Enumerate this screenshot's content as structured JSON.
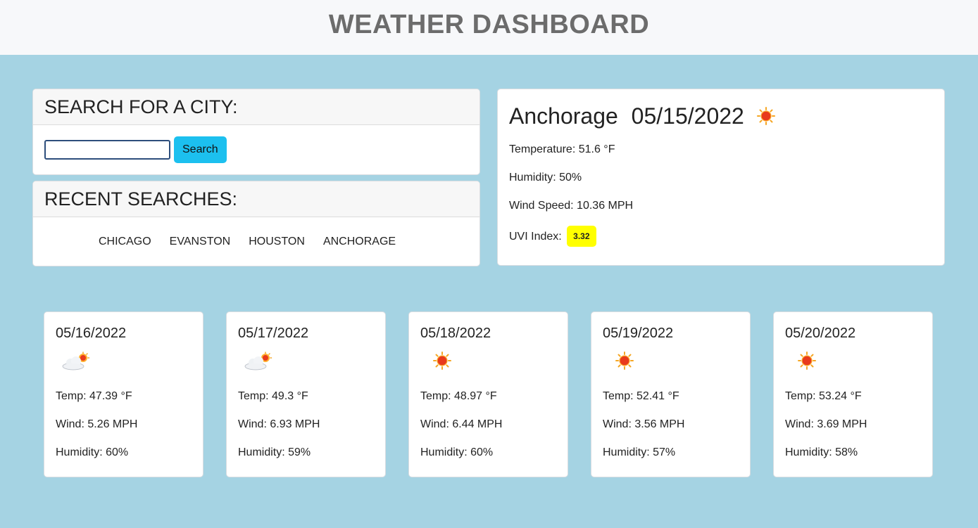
{
  "header": {
    "title": "WEATHER DASHBOARD"
  },
  "search": {
    "heading": "SEARCH FOR A CITY:",
    "input_value": "",
    "button_label": "Search"
  },
  "recent": {
    "heading": "RECENT SEARCHES:",
    "items": [
      "CHICAGO",
      "EVANSTON",
      "HOUSTON",
      "ANCHORAGE"
    ]
  },
  "current": {
    "city": "Anchorage",
    "date": "05/15/2022",
    "icon": "sun-icon",
    "temperature": "Temperature: 51.6 °F",
    "humidity": "Humidity: 50%",
    "wind": "Wind Speed: 10.36 MPH",
    "uvi_label": "UVI Index:",
    "uvi_value": "3.32",
    "uvi_color": "#ffff00"
  },
  "forecast": [
    {
      "date": "05/16/2022",
      "icon": "partly-cloudy-icon",
      "temp": "Temp: 47.39 °F",
      "wind": "Wind: 5.26 MPH",
      "humidity": "Humidity: 60%"
    },
    {
      "date": "05/17/2022",
      "icon": "partly-cloudy-icon",
      "temp": "Temp: 49.3 °F",
      "wind": "Wind: 6.93 MPH",
      "humidity": "Humidity: 59%"
    },
    {
      "date": "05/18/2022",
      "icon": "sun-icon",
      "temp": "Temp: 48.97 °F",
      "wind": "Wind: 6.44 MPH",
      "humidity": "Humidity: 60%"
    },
    {
      "date": "05/19/2022",
      "icon": "sun-icon",
      "temp": "Temp: 52.41 °F",
      "wind": "Wind: 3.56 MPH",
      "humidity": "Humidity: 57%"
    },
    {
      "date": "05/20/2022",
      "icon": "sun-icon",
      "temp": "Temp: 53.24 °F",
      "wind": "Wind: 3.69 MPH",
      "humidity": "Humidity: 58%"
    }
  ],
  "colors": {
    "background": "#a5d3e3",
    "button": "#1cc0ef",
    "header_bg": "#f7f8fa"
  }
}
